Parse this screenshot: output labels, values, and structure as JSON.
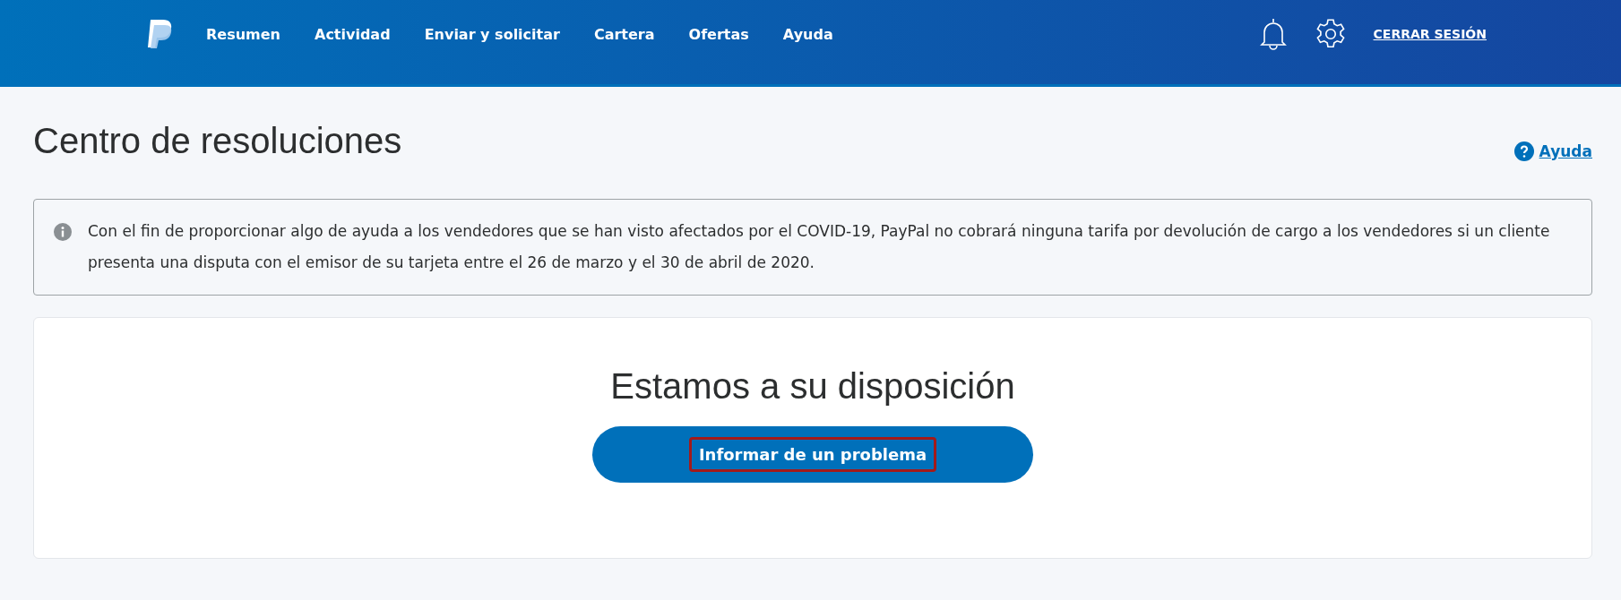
{
  "nav": {
    "items": [
      {
        "label": "Resumen"
      },
      {
        "label": "Actividad"
      },
      {
        "label": "Enviar y solicitar"
      },
      {
        "label": "Cartera"
      },
      {
        "label": "Ofertas"
      },
      {
        "label": "Ayuda"
      }
    ],
    "logout": "CERRAR SESIÓN"
  },
  "page": {
    "title": "Centro de resoluciones",
    "help_link": "Ayuda"
  },
  "notice": {
    "text": "Con el fin de proporcionar algo de ayuda a los vendedores que se han visto afectados por el COVID-19, PayPal no cobrará ninguna tarifa por devolución de cargo a los vendedores si un cliente presenta una disputa con el emisor de su tarjeta entre el 26 de marzo y el 30 de abril de 2020."
  },
  "card": {
    "heading": "Estamos a su disposición",
    "button": {
      "label": "Informar de un problema",
      "highlighted": true
    }
  }
}
